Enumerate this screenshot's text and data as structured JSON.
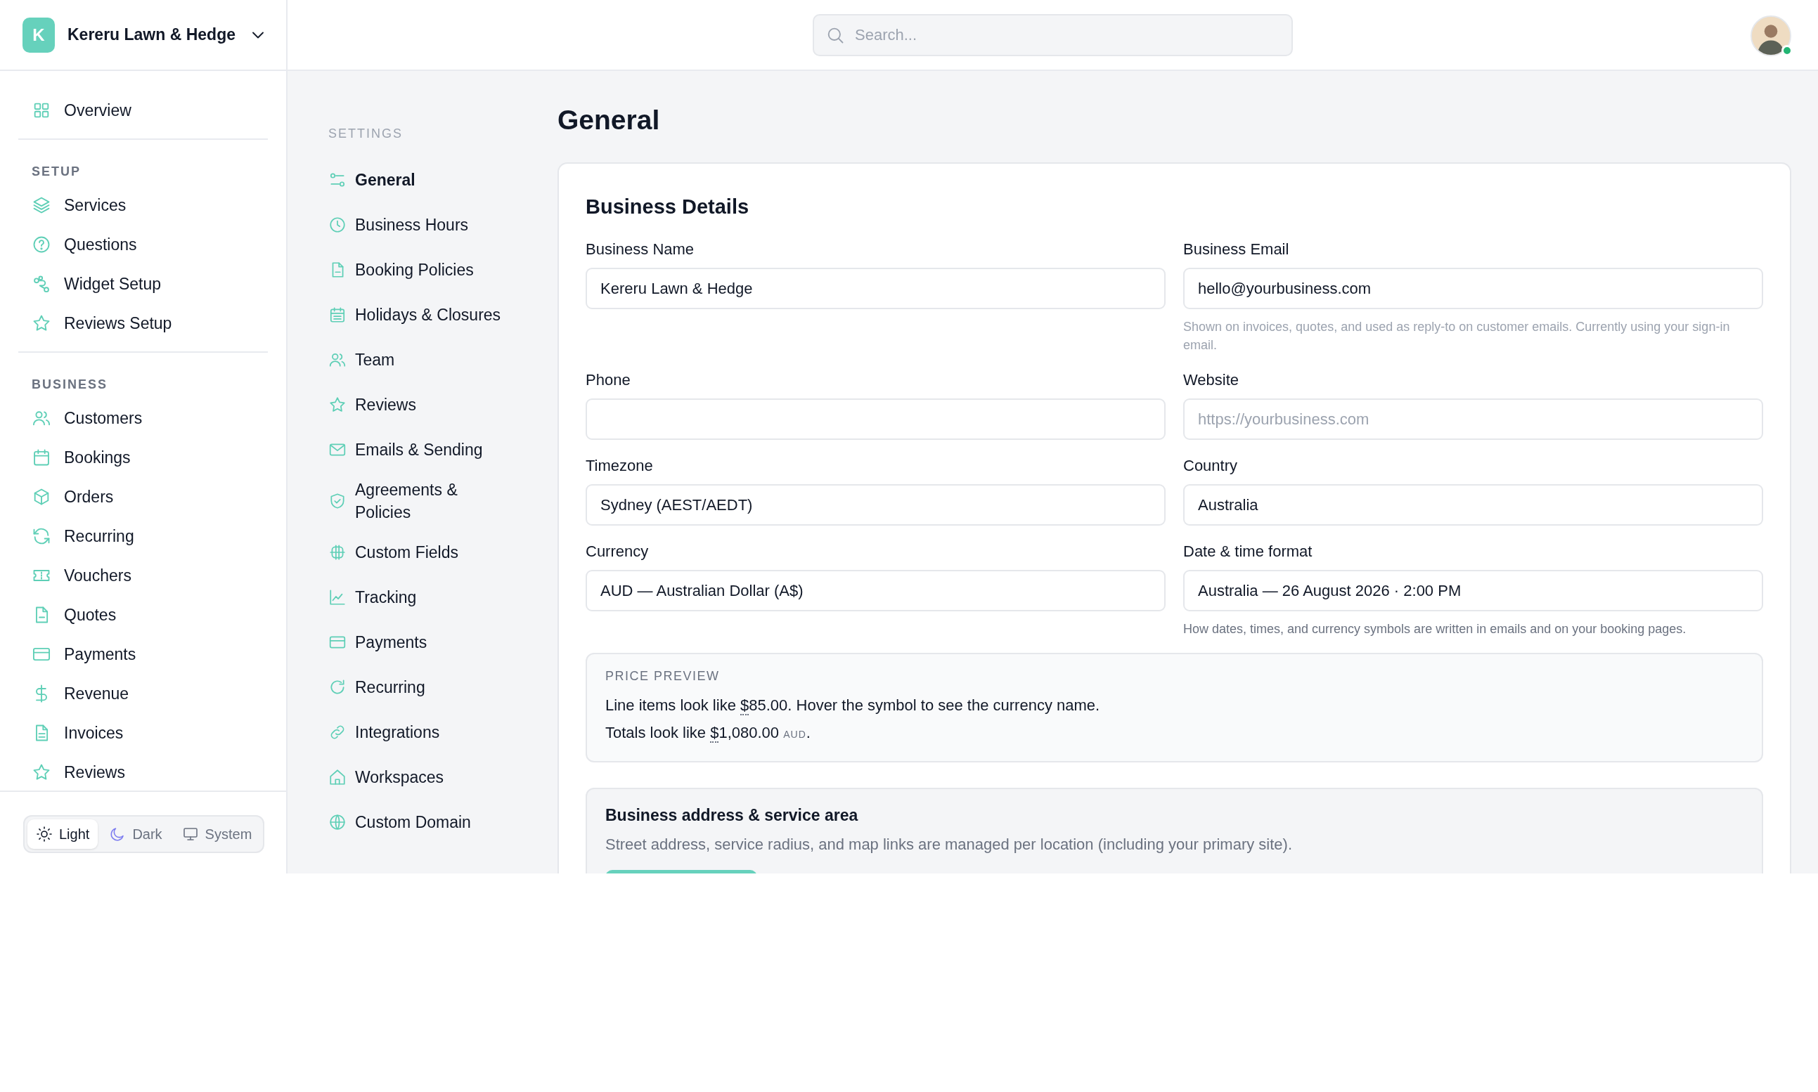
{
  "workspace": {
    "initial": "K",
    "name": "Kereru Lawn & Hedge"
  },
  "search": {
    "placeholder": "Search..."
  },
  "user": {
    "online": true
  },
  "sidebar": {
    "top": [
      {
        "label": "Overview",
        "selected": false
      }
    ],
    "sections": [
      {
        "title": "SETUP",
        "items": [
          {
            "label": "Services",
            "selected": false
          },
          {
            "label": "Questions",
            "selected": false
          },
          {
            "label": "Widget Setup",
            "selected": false
          },
          {
            "label": "Reviews Setup",
            "selected": false
          }
        ]
      },
      {
        "title": "BUSINESS",
        "items": [
          {
            "label": "Customers",
            "selected": false
          },
          {
            "label": "Bookings",
            "selected": false
          },
          {
            "label": "Orders",
            "selected": false
          },
          {
            "label": "Recurring",
            "selected": false
          },
          {
            "label": "Vouchers",
            "selected": false
          },
          {
            "label": "Quotes",
            "selected": false
          },
          {
            "label": "Payments",
            "selected": false
          },
          {
            "label": "Revenue",
            "selected": false
          },
          {
            "label": "Invoices",
            "selected": false
          },
          {
            "label": "Reviews",
            "selected": false
          }
        ]
      }
    ]
  },
  "theme": [
    {
      "label": "Light",
      "selected": true
    },
    {
      "label": "Dark",
      "selected": false
    },
    {
      "label": "System",
      "selected": false
    }
  ],
  "settings_nav": {
    "title": "SETTINGS",
    "items": [
      {
        "label": "General",
        "selected": true
      },
      {
        "label": "Business Hours",
        "selected": false
      },
      {
        "label": "Booking Policies",
        "selected": false
      },
      {
        "label": "Holidays & Closures",
        "selected": false
      },
      {
        "label": "Team",
        "selected": false
      },
      {
        "label": "Reviews",
        "selected": false
      },
      {
        "label": "Emails & Sending",
        "selected": false
      },
      {
        "label": "Agreements & Policies",
        "selected": false
      },
      {
        "label": "Custom Fields",
        "selected": false
      },
      {
        "label": "Tracking",
        "selected": false
      },
      {
        "label": "Payments",
        "selected": false
      },
      {
        "label": "Recurring",
        "selected": false
      },
      {
        "label": "Integrations",
        "selected": false
      },
      {
        "label": "Workspaces",
        "selected": false
      },
      {
        "label": "Custom Domain",
        "selected": false
      }
    ]
  },
  "page_title": "General",
  "card": {
    "title": "Business Details",
    "fields": [
      {
        "label": "Business Name",
        "value": "Kereru Lawn & Hedge"
      },
      {
        "label": "Business Email",
        "value": "hello@yourbusiness.com",
        "help": "Shown on invoices, quotes, and used as reply-to on customer emails. Currently using your sign-in email."
      },
      {
        "label": "Phone"
      },
      {
        "label": "Website",
        "placeholder": "https://yourbusiness.com"
      },
      {
        "label": "Timezone",
        "value": "Sydney (AEST/AEDT)"
      },
      {
        "label": "Country",
        "value": "Australia"
      },
      {
        "label": "Currency",
        "value": "AUD — Australian Dollar (A$)"
      },
      {
        "label": "Date & time format",
        "value": "Australia — 26 August 2026 · 2:00 PM",
        "help": "How dates, times, and currency symbols are written in emails and on your booking pages."
      }
    ],
    "price_preview": {
      "title": "PRICE PREVIEW",
      "lines": [
        [
          {
            "kind": "text",
            "text": "Line items look like "
          },
          {
            "kind": "symbol",
            "text": "$"
          },
          {
            "kind": "text",
            "text": "85.00. Hover the symbol to see the currency name."
          }
        ],
        [
          {
            "kind": "text",
            "text": "Totals look like "
          },
          {
            "kind": "symbol",
            "text": "$"
          },
          {
            "kind": "text",
            "text": "1,080.00 "
          },
          {
            "kind": "unit",
            "text": "AUD"
          },
          {
            "kind": "text",
            "text": "."
          }
        ]
      ]
    },
    "address": {
      "title": "Business address & service area",
      "text": "Street address, service radius, and map links are managed per location (including your primary site)."
    }
  }
}
